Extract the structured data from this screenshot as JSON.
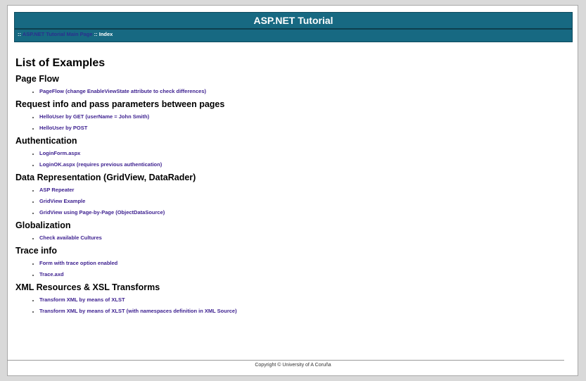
{
  "header": {
    "title": "ASP.NET Tutorial",
    "breadcrumb_prefix": ":: ",
    "breadcrumb_link": "ASP.NET Tutorial Main Page",
    "breadcrumb_sep": " :: ",
    "breadcrumb_current": "Index"
  },
  "main": {
    "title": "List of Examples",
    "sections": [
      {
        "heading": "Page Flow",
        "links": [
          "PageFlow (change EnableViewState attribute to check differences)"
        ]
      },
      {
        "heading": "Request info and pass parameters between pages",
        "links": [
          "HelloUser by GET (userName = John Smith)",
          "HelloUser by POST"
        ]
      },
      {
        "heading": "Authentication",
        "links": [
          "LoginForm.aspx",
          "LoginOK.aspx (requires previous authentication)"
        ]
      },
      {
        "heading": "Data Representation (GridView, DataRader)",
        "links": [
          "ASP Repeater",
          "GridView Example",
          "GridView using Page-by-Page (ObjectDataSource)"
        ]
      },
      {
        "heading": "Globalization",
        "links": [
          "Check available Cultures"
        ]
      },
      {
        "heading": "Trace info",
        "links": [
          "Form with trace option enabled",
          "Trace.axd"
        ]
      },
      {
        "heading": "XML Resources & XSL Transforms",
        "links": [
          "Transform XML by means of XLST",
          "Transform XML by means of XLST (with namespaces definition in XML Source)"
        ]
      }
    ]
  },
  "footer": {
    "copyright": "Copyright © University of A Coruña"
  },
  "colors": {
    "header_bg": "#176982",
    "link": "#3c1f8f"
  }
}
